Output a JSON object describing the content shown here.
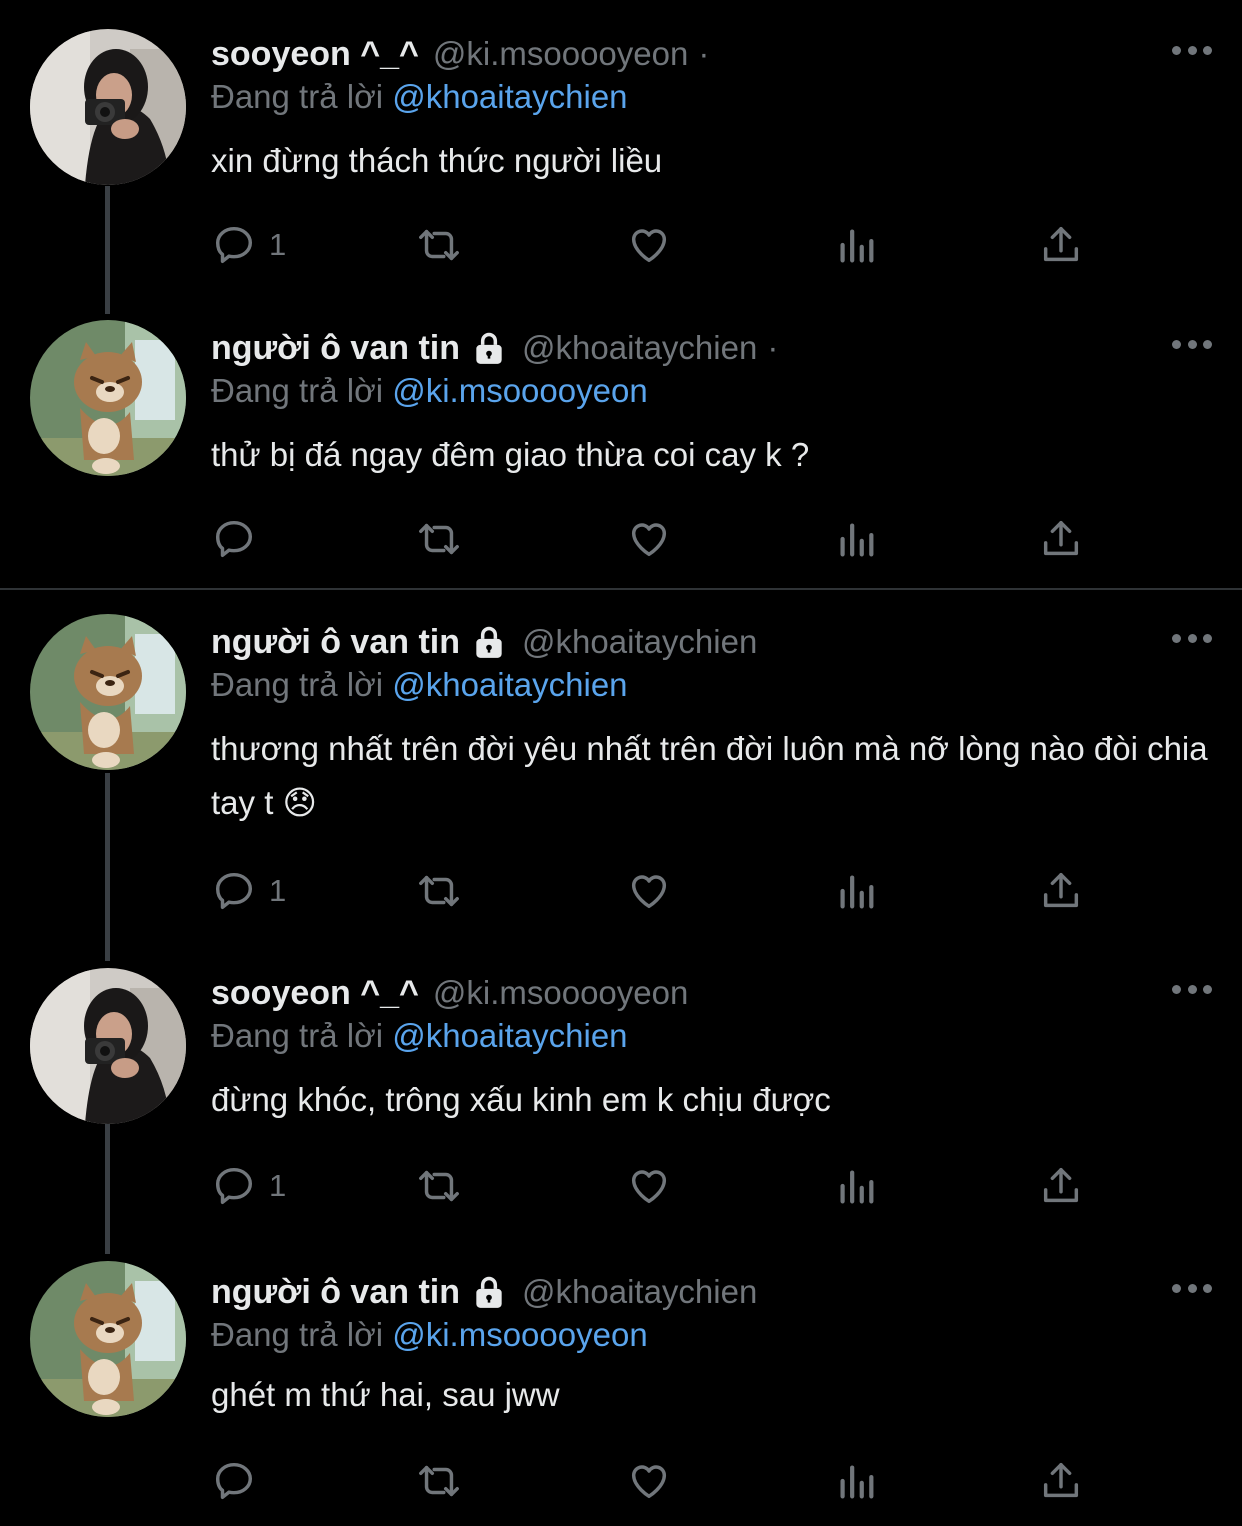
{
  "tweets": [
    {
      "name": "sooyeon ^_^",
      "handle": "@ki.msooooyeon",
      "dot": "·",
      "replying_label": "Đang trả lời",
      "reply_to": "@khoaitaychien",
      "text": "xin đừng thách thức người liều",
      "reply_count": "1",
      "protected": false,
      "avatar": "girl-with-camera-avatar"
    },
    {
      "name": "người ô van tin",
      "handle": "@khoaitaychien",
      "dot": "·",
      "replying_label": "Đang trả lời",
      "reply_to": "@ki.msooooyeon",
      "text": "thử bị đá ngay đêm giao thừa coi cay k ?",
      "reply_count": "",
      "protected": true,
      "avatar": "cartoon-bear-avatar"
    },
    {
      "name": "người ô van tin",
      "handle": "@khoaitaychien",
      "dot": "",
      "replying_label": "Đang trả lời",
      "reply_to": "@khoaitaychien",
      "text": "thương nhất trên đời yêu nhất trên đời luôn mà nỡ lòng nào đòi chia tay t 😞",
      "reply_count": "1",
      "protected": true,
      "avatar": "cartoon-bear-avatar"
    },
    {
      "name": "sooyeon ^_^",
      "handle": "@ki.msooooyeon",
      "dot": "",
      "replying_label": "Đang trả lời",
      "reply_to": "@khoaitaychien",
      "text": "đừng khóc, trông xấu kinh em k chịu được",
      "reply_count": "1",
      "protected": false,
      "avatar": "girl-with-camera-avatar"
    },
    {
      "name": "người ô van tin",
      "handle": "@khoaitaychien",
      "dot": "",
      "replying_label": "Đang trả lời",
      "reply_to": "@ki.msooooyeon",
      "text": "ghét m thứ hai, sau jww",
      "reply_count": "",
      "protected": true,
      "avatar": "cartoon-bear-avatar"
    }
  ],
  "icons": {
    "reply": "reply-icon",
    "retweet": "retweet-icon",
    "like": "like-icon",
    "views": "views-icon",
    "share": "share-icon",
    "more": "more-icon",
    "lock": "lock-icon"
  },
  "colors": {
    "background": "#000000",
    "text": "#e7e9ea",
    "secondary": "#71767b",
    "mention": "#5aa4ec",
    "divider": "#2f3336"
  }
}
